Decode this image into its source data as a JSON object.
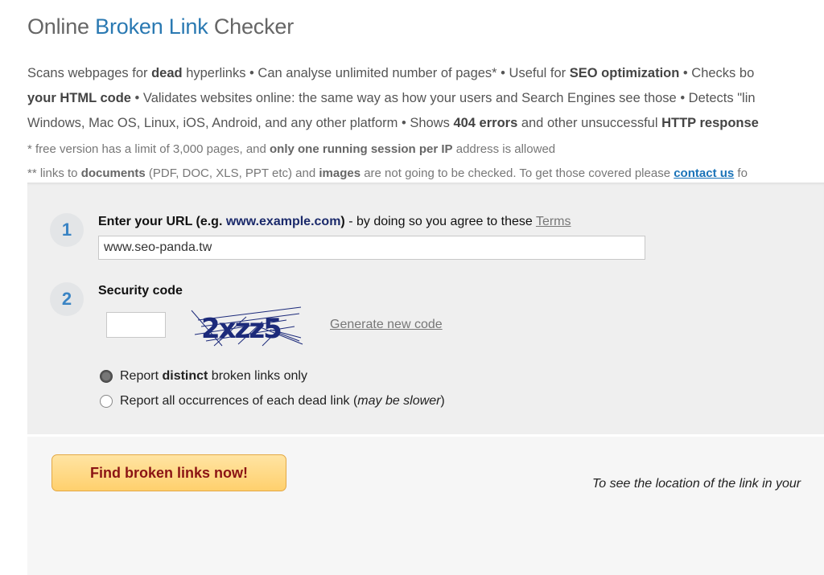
{
  "header": {
    "title_part1": "Online ",
    "title_accent": "Broken Link",
    "title_part2": " Checker"
  },
  "features": {
    "line1": [
      {
        "t": "Scans webpages for ",
        "b": false
      },
      {
        "t": "dead",
        "b": true
      },
      {
        "t": " hyperlinks • Can analyse unlimited number of pages* • Useful for ",
        "b": false
      },
      {
        "t": "SEO optimization",
        "b": true
      },
      {
        "t": " • Checks bo",
        "b": false
      }
    ],
    "line2": [
      {
        "t": "your HTML code",
        "b": true
      },
      {
        "t": " • Validates websites online: the same way as how your users and Search Engines see those • Detects \"lin",
        "b": false
      }
    ],
    "line3": [
      {
        "t": "Windows, Mac OS, Linux, iOS, Android, and any other platform • Shows ",
        "b": false
      },
      {
        "t": "404 errors",
        "b": true
      },
      {
        "t": " and other unsuccessful ",
        "b": false
      },
      {
        "t": "HTTP response",
        "b": true
      }
    ]
  },
  "notes": {
    "note1_prefix": "*  free version has a limit of 3,000 pages, and ",
    "note1_bold": "only one running session per IP",
    "note1_suffix": " address is allowed",
    "note2_prefix": "** links to ",
    "note2_bold1": "documents",
    "note2_mid": " (PDF, DOC, XLS, PPT etc) and ",
    "note2_bold2": "images",
    "note2_suffix": " are not going to be checked. To get those covered please ",
    "note2_link": "contact us",
    "note2_tail": " fo"
  },
  "form": {
    "step1": {
      "number": "1",
      "label_bold": "Enter your URL (e.g. ",
      "label_example": "www.example.com",
      "label_close": ")",
      "label_rest": " - by doing so you agree to these ",
      "terms_link": "Terms",
      "url_value": "www.seo-panda.tw"
    },
    "step2": {
      "number": "2",
      "label": "Security code",
      "code_value": "",
      "captcha_text": "2xzz5",
      "generate_link": "Generate new code"
    },
    "options": [
      {
        "prefix": "Report ",
        "bold": "distinct",
        "suffix": " broken links only",
        "italic": "",
        "close": "",
        "checked": true
      },
      {
        "prefix": "Report all occurrences of each dead link (",
        "bold": "",
        "suffix": "",
        "italic": "may be slower",
        "close": ")",
        "checked": false
      }
    ]
  },
  "actions": {
    "submit_label": "Find broken links now!",
    "hint_text": "To see the location of the link in your"
  },
  "colors": {
    "accent": "#2a79b2",
    "button_text": "#8b1414",
    "button_bg": "#ffd06d",
    "link": "#1a73b8"
  }
}
